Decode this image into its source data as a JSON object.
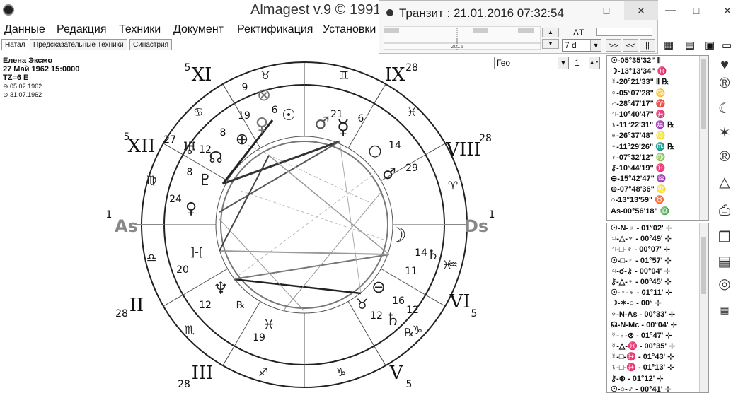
{
  "window": {
    "title": "Almagest v.9 © 1991-2",
    "minimize": "—",
    "maximize": "□",
    "close": "✕"
  },
  "menu": [
    "Данные",
    "Редакция",
    "Техники",
    "Документ",
    "Ректификация",
    "Установки"
  ],
  "tabs": [
    "Натал",
    "Предсказательные Техники",
    "Синастрия"
  ],
  "person": {
    "name": "Елена Эксмо",
    "date": "27 Май 1962 15:0000",
    "tz": "TZ=6 E",
    "d1": "05.02.1962",
    "d2": "31.07.1962"
  },
  "transit": {
    "title": "Транзит : 21.01.2016  07:32:54",
    "delta": "ΔT",
    "step": "7 d",
    "timeline_year": "2016",
    "buttons": [
      ">>",
      "<<",
      "||"
    ]
  },
  "geo": {
    "value": "Гео",
    "num": "1"
  },
  "chart": {
    "axis_asc": "As",
    "axis_dsc": "Ds",
    "houses": [
      {
        "num": "XI",
        "deg": "5"
      },
      {
        "num": "IX",
        "deg": "28"
      },
      {
        "num": "XII",
        "deg": "5"
      },
      {
        "num": "VIII",
        "deg": "28"
      },
      {
        "num": "II",
        "deg": "28"
      },
      {
        "num": "VI",
        "deg": "5"
      },
      {
        "num": "III",
        "deg": "28"
      },
      {
        "num": "V",
        "deg": "5"
      }
    ],
    "axis_deg_left": "1",
    "axis_deg_right": "1",
    "inner_numbers": [
      "9",
      "19",
      "6",
      "21",
      "6",
      "8",
      "12",
      "27",
      "8",
      "24",
      "14",
      "29",
      "14",
      "11",
      "20",
      "12",
      "16",
      "12",
      "19",
      "12"
    ]
  },
  "planets": [
    "☉-05°35'32\" Ⅱ",
    "☽-13°13'34\" ♓",
    "☿-20°21'33\" Ⅱ ℞",
    "♀-05°07'28\" ♋",
    "♂-28°47'17\" ♈",
    "♃-10°40'47\" ♓",
    "♄-11°22'31\" ♒ ℞",
    "♅-26°37'48\" ♌",
    "♆-11°29'26\" ♏ ℞",
    "♇-07°32'12\" ♍",
    "⚷-10°44'19\" ♓",
    "⊖-15°42'47\" ♒",
    "⊕-07°48'36\" ♌",
    "○-13°13'59\" ♉",
    "As-00°56'18\" ♎"
  ],
  "aspects": [
    "☉-N-♅ - 01°02' ⊹",
    "♃-△-♆ - 00°49' ⊹",
    "♃-□-♆ - 00°07' ⊹",
    "☉-□-♇ - 01°57' ⊹",
    "♃-☌-⚷ - 00°04' ⊹",
    "⚷-△-♆ - 00°45' ⊹",
    "☉-♀-♆ - 01°11' ⊹",
    "☽-✶-○ - 00° ⊹",
    "♆-N-As - 00°33' ⊹",
    "☊-N-Mc - 00°04' ⊹",
    "☿-♀-⊗ - 01°47' ⊹",
    "☿-△-♓ - 00°35' ⊹",
    "☿-□-♓ - 01°43' ⊹",
    "♄-□-♓ - 01°13' ⊹",
    "⚷-⊗ - 01°12' ⊹",
    "☉-○-♂ - 00°41' ⊹"
  ],
  "colors": {
    "ring": "#222",
    "aspect_dark": "#333",
    "aspect_grey": "#999"
  }
}
